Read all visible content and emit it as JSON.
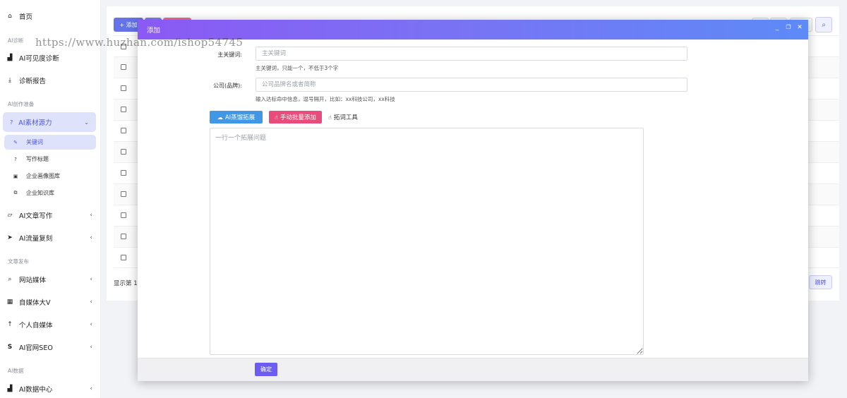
{
  "sidebar": {
    "home": "首页",
    "sec_diag": "AI诊断",
    "diag_visibility": "AI可见度诊断",
    "diag_report": "诊断报告",
    "sec_creation": "AI创作准备",
    "material": "AI素材源力",
    "sub_keywords": "关键词",
    "sub_titles": "写作标题",
    "sub_images": "企业画像图库",
    "sub_knowledge": "企业知识库",
    "article_writing": "AI文章写作",
    "traffic_copy": "AI流量复刻",
    "sec_publish": "文章发布",
    "site_media": "网站媒体",
    "self_media": "自媒体大V",
    "personal_media": "个人自媒体",
    "seo": "AI官网SEO",
    "sec_data": "AI数据",
    "data_center": "AI数据中心"
  },
  "background_page": {
    "add_label": "添加",
    "showing": "显示第 1",
    "jump": "跳转"
  },
  "modal": {
    "title": "添加",
    "keyword_label": "主关键词:",
    "keyword_placeholder": "主关键词",
    "keyword_hint": "主关键词，只能一个，不低于3个字",
    "company_label": "公司(品牌):",
    "company_placeholder": "公司品牌名或者简称",
    "company_hint": "输入达标命中信息，逗号隔开，比如：xx科技公司，xx科技",
    "ai_expand": "AI蒸馏拓展",
    "manual_add": "手动批量添加",
    "tool": "拓词工具",
    "textarea_placeholder": "一行一个拓展问题",
    "confirm": "确定"
  },
  "watermark": "https://www.huzhan.com/ishop54745",
  "colors": {
    "accent": "#4b55d6",
    "header_gradient_start": "#8b59f4",
    "header_gradient_end": "#5d8af7",
    "ai_button": "#3f97e6",
    "manual_button": "#e84c7b"
  }
}
